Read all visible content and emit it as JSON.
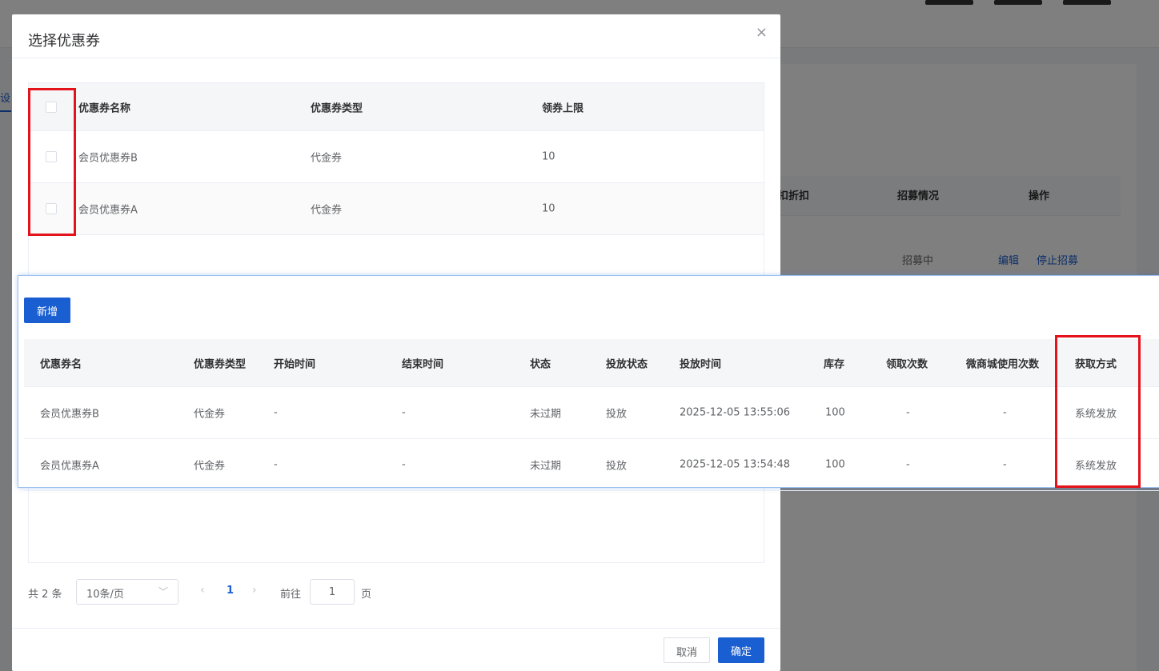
{
  "modal": {
    "title": "选择优惠券",
    "close_icon": "×",
    "columns": [
      "优惠券名称",
      "优惠券类型",
      "领券上限"
    ],
    "rows": [
      {
        "name": "会员优惠券B",
        "type": "代金券",
        "limit": "10"
      },
      {
        "name": "会员优惠券A",
        "type": "代金券",
        "limit": "10"
      }
    ],
    "pagination": {
      "total": "共 2 条",
      "page_size": "10条/页",
      "prev": "‹",
      "current": "1",
      "next": "›",
      "goto_label": "前往",
      "goto_value": "1",
      "page_label": "页"
    },
    "cancel_label": "取消",
    "confirm_label": "确定"
  },
  "background": {
    "tab_partial": "设",
    "columns": [
      "扣折扣",
      "招募情况",
      "操作"
    ],
    "row": {
      "status": "招募中",
      "edit": "编辑",
      "stop": "停止招募"
    }
  },
  "panel": {
    "add_label": "新增",
    "columns": [
      "优惠券名",
      "优惠券类型",
      "开始时间",
      "结束时间",
      "状态",
      "投放状态",
      "投放时间",
      "库存",
      "领取次数",
      "微商城使用次数",
      "获取方式"
    ],
    "rows": [
      [
        "会员优惠券B",
        "代金券",
        "-",
        "-",
        "未过期",
        "投放",
        "2025-12-05 13:55:06",
        "100",
        "-",
        "-",
        "系统发放"
      ],
      [
        "会员优惠券A",
        "代金券",
        "-",
        "-",
        "未过期",
        "投放",
        "2025-12-05 13:54:48",
        "100",
        "-",
        "-",
        "系统发放"
      ]
    ]
  },
  "colors": {
    "primary": "#1a5fd1",
    "highlight": "#e3121b"
  }
}
